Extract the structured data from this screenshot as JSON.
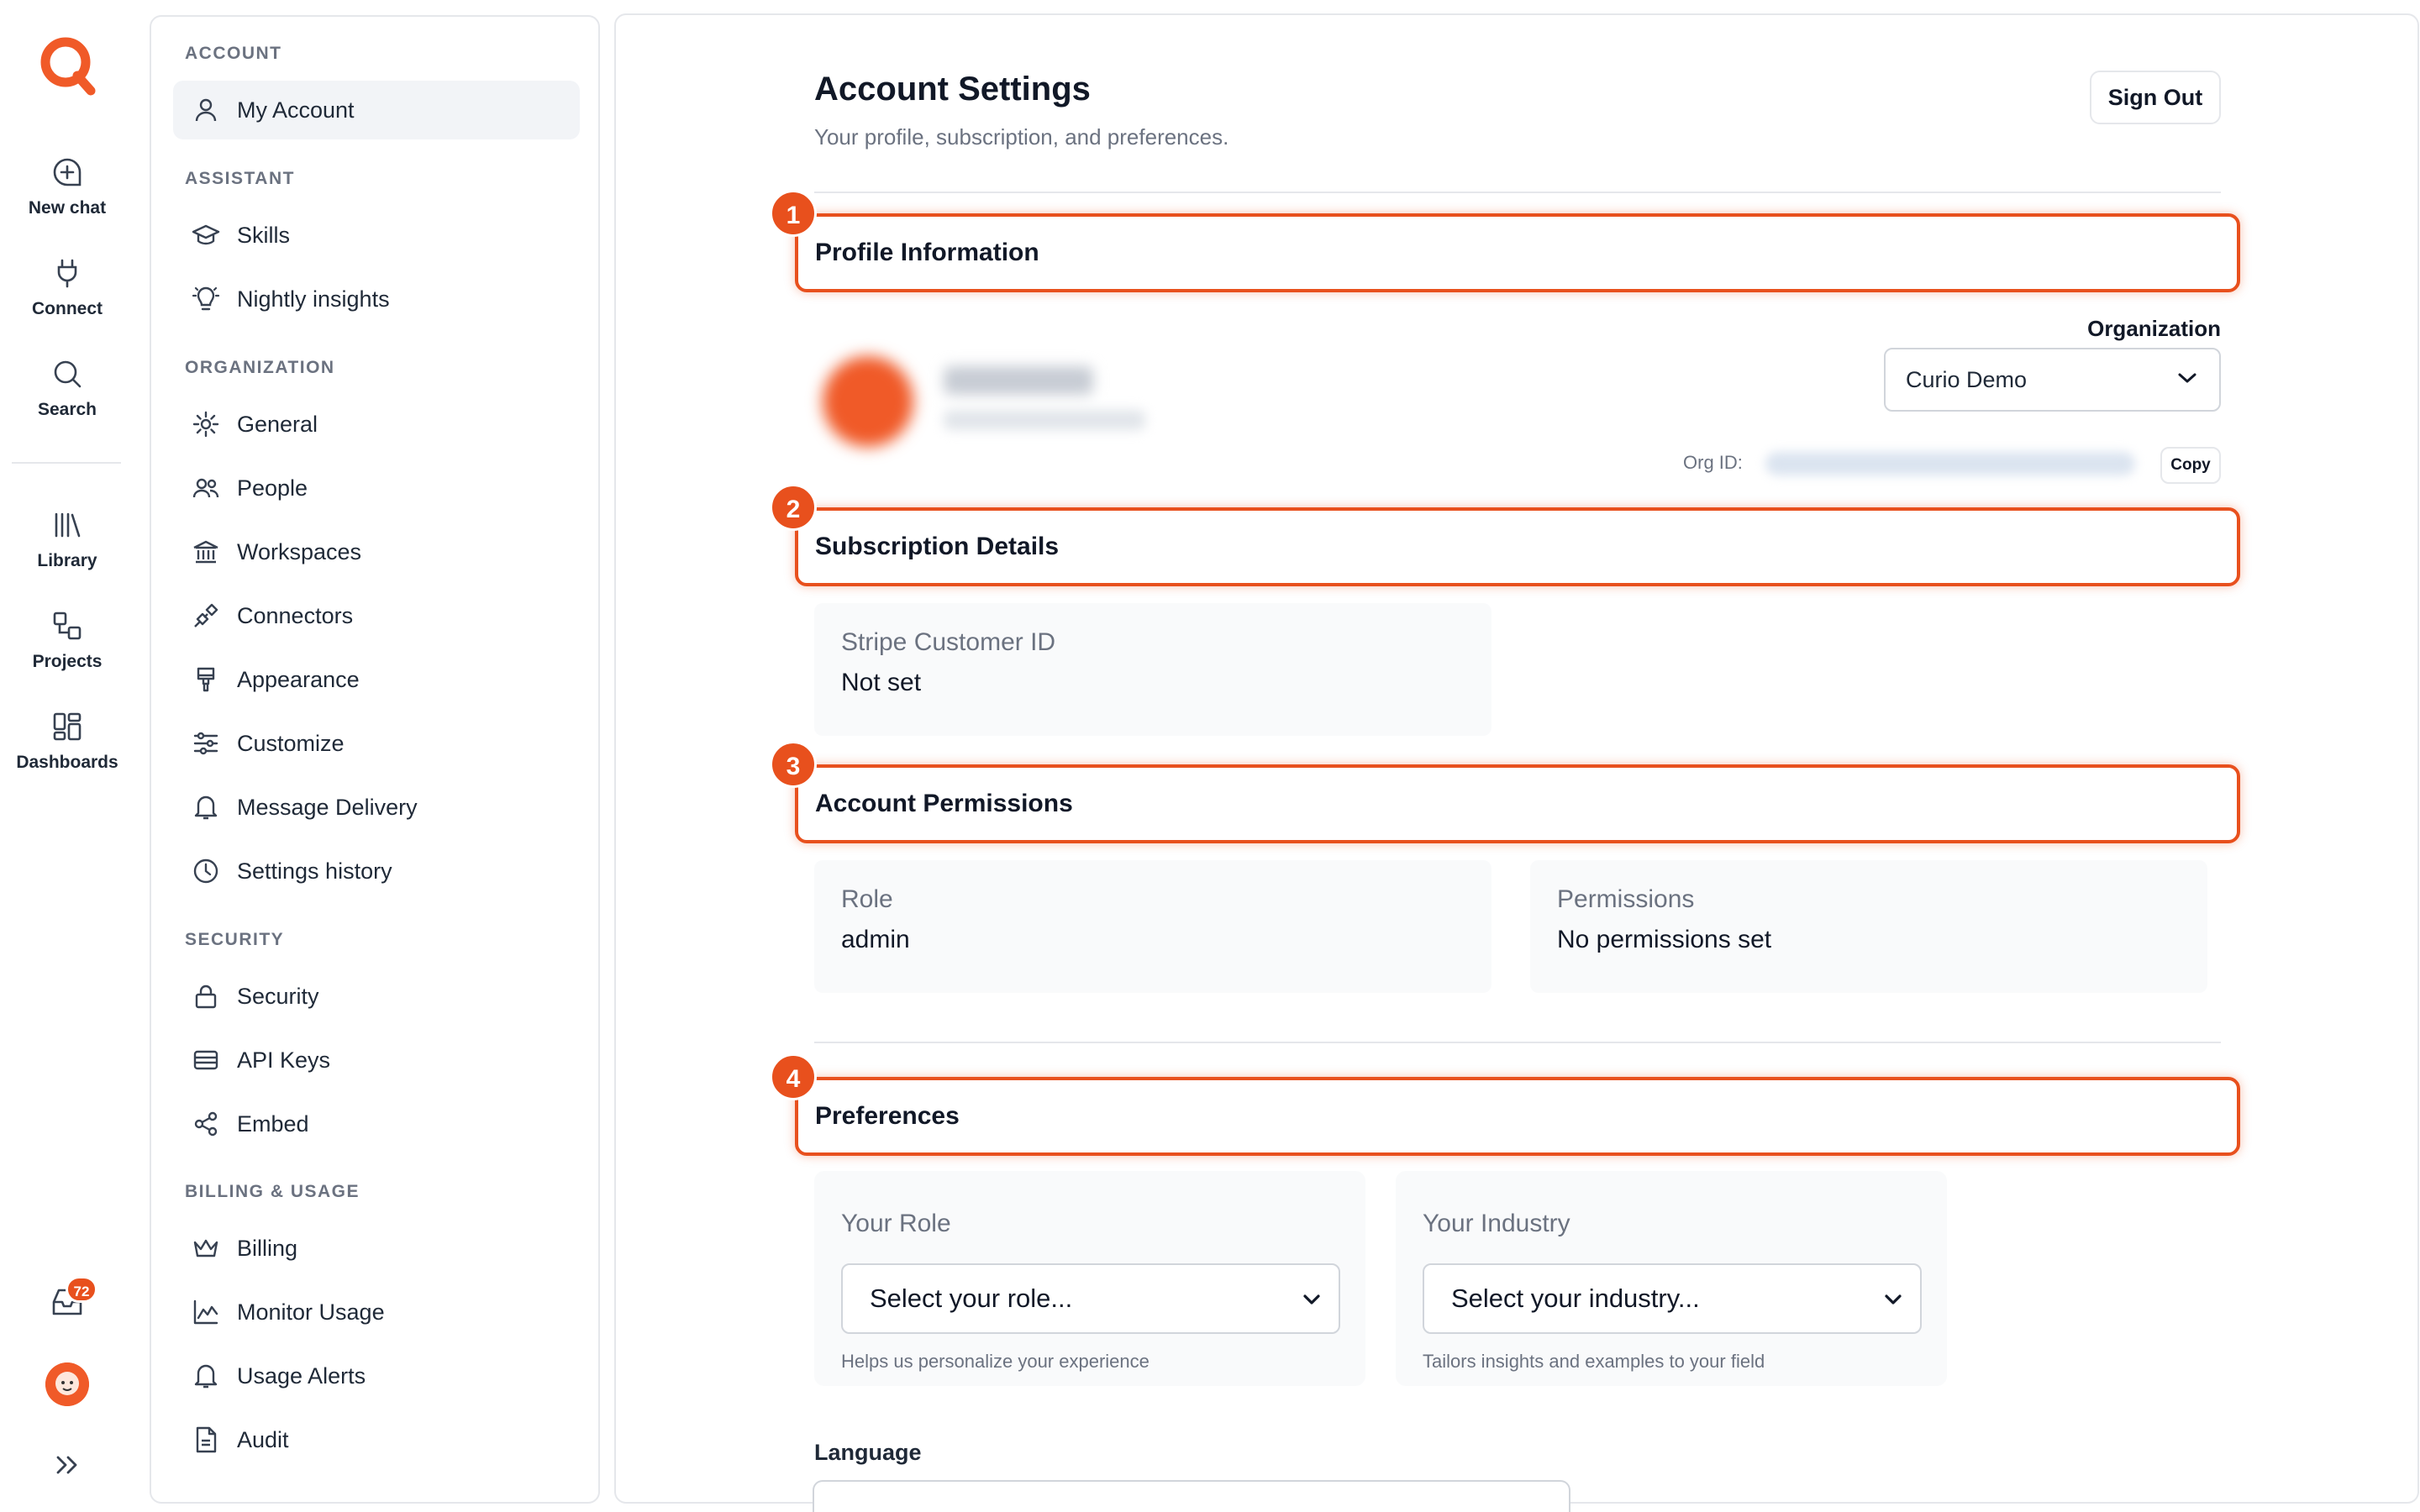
{
  "rail": {
    "items": [
      {
        "label": "New chat",
        "icon": "new-chat-icon"
      },
      {
        "label": "Connect",
        "icon": "plug-icon"
      },
      {
        "label": "Search",
        "icon": "search-icon"
      },
      {
        "label": "Library",
        "icon": "library-icon"
      },
      {
        "label": "Projects",
        "icon": "projects-icon"
      },
      {
        "label": "Dashboards",
        "icon": "dashboards-icon"
      }
    ],
    "inbox_badge": "72"
  },
  "sidebar": {
    "sections": {
      "account": "ACCOUNT",
      "assistant": "ASSISTANT",
      "organization": "ORGANIZATION",
      "security": "SECURITY",
      "billing": "BILLING & USAGE"
    },
    "items": {
      "my_account": "My Account",
      "skills": "Skills",
      "nightly_insights": "Nightly insights",
      "general": "General",
      "people": "People",
      "workspaces": "Workspaces",
      "connectors": "Connectors",
      "appearance": "Appearance",
      "customize": "Customize",
      "message_delivery": "Message Delivery",
      "settings_history": "Settings history",
      "security": "Security",
      "api_keys": "API Keys",
      "embed": "Embed",
      "billing": "Billing",
      "monitor_usage": "Monitor Usage",
      "usage_alerts": "Usage Alerts",
      "audit": "Audit"
    }
  },
  "main": {
    "title": "Account Settings",
    "subtitle": "Your profile, subscription, and preferences.",
    "sign_out": "Sign Out",
    "sections": [
      {
        "step": "1",
        "title": "Profile Information"
      },
      {
        "step": "2",
        "title": "Subscription Details"
      },
      {
        "step": "3",
        "title": "Account Permissions"
      },
      {
        "step": "4",
        "title": "Preferences"
      }
    ],
    "profile": {
      "organization_label": "Organization",
      "organization_value": "Curio Demo",
      "org_id_label": "Org ID:",
      "copy_label": "Copy"
    },
    "subscription": {
      "stripe_label": "Stripe Customer ID",
      "stripe_value": "Not set"
    },
    "permissions": {
      "role_label": "Role",
      "role_value": "admin",
      "permissions_label": "Permissions",
      "permissions_value": "No permissions set"
    },
    "preferences": {
      "role_label": "Your Role",
      "role_placeholder": "Select your role...",
      "role_hint": "Helps us personalize your experience",
      "industry_label": "Your Industry",
      "industry_placeholder": "Select your industry...",
      "industry_hint": "Tailors insights and examples to your field",
      "language_label": "Language"
    }
  },
  "colors": {
    "accent": "#e8501d",
    "muted_text": "#6b7280",
    "card_bg": "#f9fafb",
    "active_nav_bg": "#f2f4f7"
  }
}
